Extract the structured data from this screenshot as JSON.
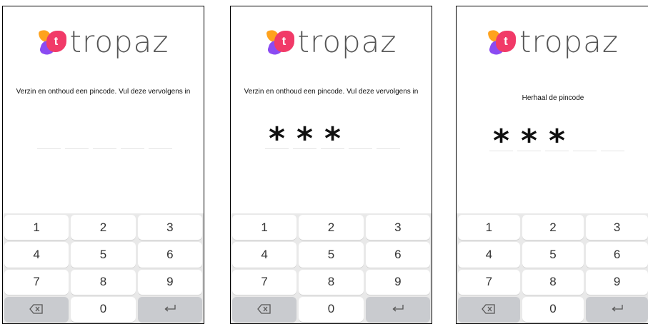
{
  "brand": {
    "name": "tropaz",
    "mark_letter": "t"
  },
  "screens": [
    {
      "prompt": "Verzin en onthoud een pincode. Vul deze vervolgens in",
      "pin": [
        "",
        "",
        "",
        "",
        ""
      ]
    },
    {
      "prompt": "Verzin en onthoud een pincode. Vul deze vervolgens in",
      "pin": [
        "*",
        "*",
        "*",
        "",
        ""
      ]
    },
    {
      "prompt": "Herhaal de pincode",
      "pin": [
        "*",
        "*",
        "*",
        "",
        ""
      ]
    }
  ],
  "keypad": {
    "keys": [
      "1",
      "2",
      "3",
      "4",
      "5",
      "6",
      "7",
      "8",
      "9"
    ],
    "zero": "0",
    "backspace_icon": "backspace-icon",
    "enter_icon": "enter-icon"
  },
  "colors": {
    "orange": "#ffa21d",
    "pink": "#f13a68",
    "purple": "#8b4bf2",
    "keyboard_bg": "#e9e9e9",
    "function_key": "#c9cbcf"
  }
}
